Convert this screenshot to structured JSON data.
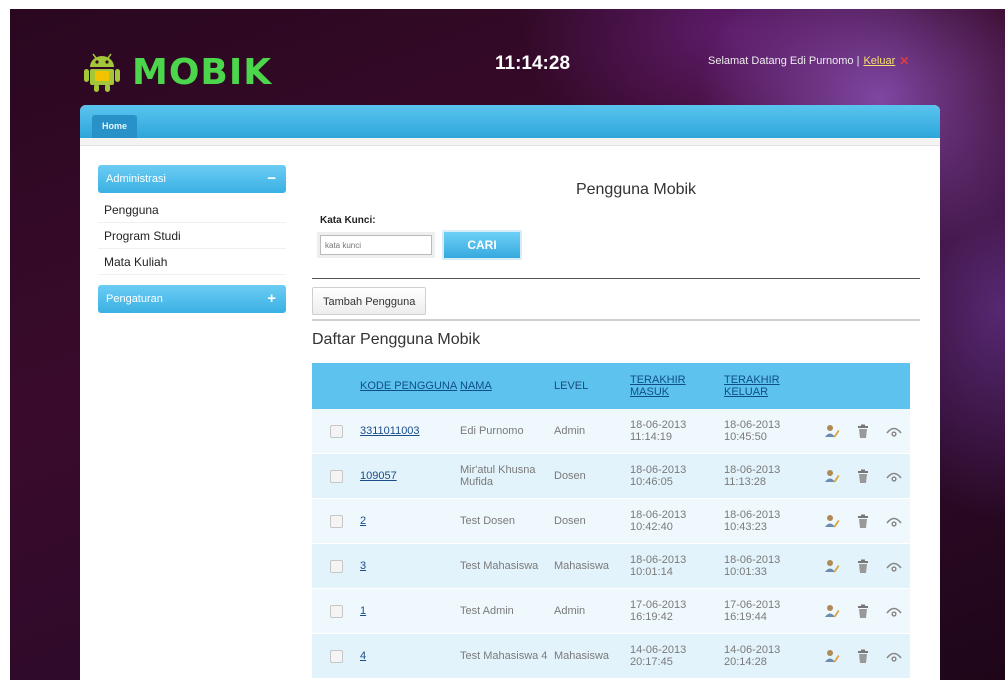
{
  "header": {
    "app_name": "MOBIK",
    "clock": "11:14:28",
    "welcome_text": "Selamat Datang Edi Purnomo |",
    "logout_label": "Keluar"
  },
  "nav": {
    "tabs": [
      {
        "label": "Home"
      }
    ]
  },
  "sidebar": {
    "sections": [
      {
        "label": "Administrasi",
        "toggle": "−",
        "items": [
          "Pengguna",
          "Program Studi",
          "Mata Kuliah"
        ]
      },
      {
        "label": "Pengaturan",
        "toggle": "+"
      }
    ]
  },
  "content": {
    "page_title": "Pengguna Mobik",
    "search": {
      "label": "Kata Kunci:",
      "placeholder": "kata kunci",
      "button_label": "CARI"
    },
    "add_button_label": "Tambah Pengguna",
    "list_title": "Daftar Pengguna Mobik"
  },
  "table": {
    "headers": {
      "kode": "KODE PENGGUNA",
      "nama": "NAMA",
      "level": "LEVEL",
      "masuk": "TERAKHIR MASUK",
      "keluar": "TERAKHIR KELUAR"
    },
    "rows": [
      {
        "kode": "3311011003",
        "nama": "Edi Purnomo",
        "level": "Admin",
        "masuk": "18-06-2013 11:14:19",
        "keluar": "18-06-2013 10:45:50"
      },
      {
        "kode": "109057",
        "nama": "Mir'atul Khusna Mufida",
        "level": "Dosen",
        "masuk": "18-06-2013 10:46:05",
        "keluar": "18-06-2013 11:13:28"
      },
      {
        "kode": "2",
        "nama": "Test Dosen",
        "level": "Dosen",
        "masuk": "18-06-2013 10:42:40",
        "keluar": "18-06-2013 10:43:23"
      },
      {
        "kode": "3",
        "nama": "Test Mahasiswa",
        "level": "Mahasiswa",
        "masuk": "18-06-2013 10:01:14",
        "keluar": "18-06-2013 10:01:33"
      },
      {
        "kode": "1",
        "nama": "Test Admin",
        "level": "Admin",
        "masuk": "17-06-2013 16:19:42",
        "keluar": "17-06-2013 16:19:44"
      },
      {
        "kode": "4",
        "nama": "Test Mahasiswa 4",
        "level": "Mahasiswa",
        "masuk": "14-06-2013 20:17:45",
        "keluar": "14-06-2013 20:14:28"
      }
    ],
    "row_icons": [
      "edit-user-icon",
      "trash-icon",
      "view-icon"
    ]
  },
  "colors": {
    "brand_green": "#4cd64c",
    "nav_blue": "#3ab1e3",
    "header_bg": "#2a0820",
    "link_blue": "#1a4d8a"
  }
}
